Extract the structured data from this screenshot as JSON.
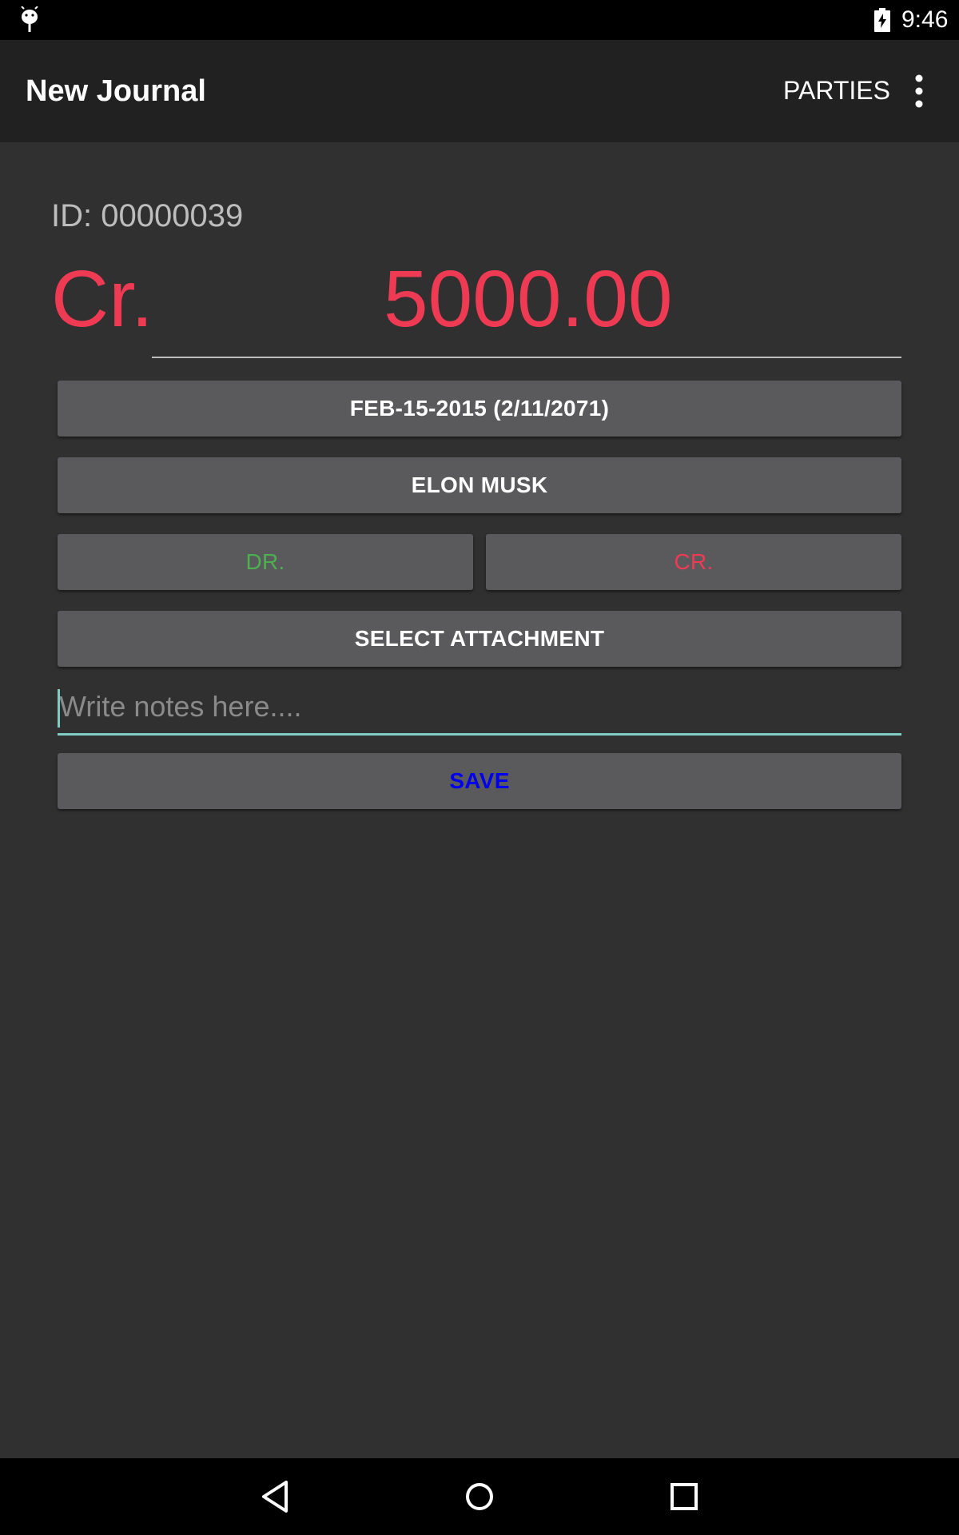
{
  "status_bar": {
    "time": "9:46",
    "left_icon": "android-icon",
    "battery_icon": "battery-charging-icon"
  },
  "app_bar": {
    "title": "New Journal",
    "parties_label": "PARTIES",
    "overflow_icon": "more-vert-icon"
  },
  "journal": {
    "id_label": "ID: 00000039",
    "entry_type": "Cr.",
    "amount": "5000.00",
    "amount_color": "#ef3a54"
  },
  "form": {
    "date_label": "FEB-15-2015 (2/11/2071)",
    "party_label": "ELON MUSK",
    "dr_label": "DR.",
    "dr_color": "#4caf50",
    "cr_label": "CR.",
    "cr_color": "#ef3a54",
    "attachment_label": "SELECT ATTACHMENT",
    "notes_value": "",
    "notes_placeholder": "Write notes here....",
    "save_label": "SAVE",
    "save_color": "#0000ee"
  },
  "nav_bar": {
    "back_icon": "back-triangle-icon",
    "home_icon": "home-circle-icon",
    "recents_icon": "recents-square-icon"
  }
}
